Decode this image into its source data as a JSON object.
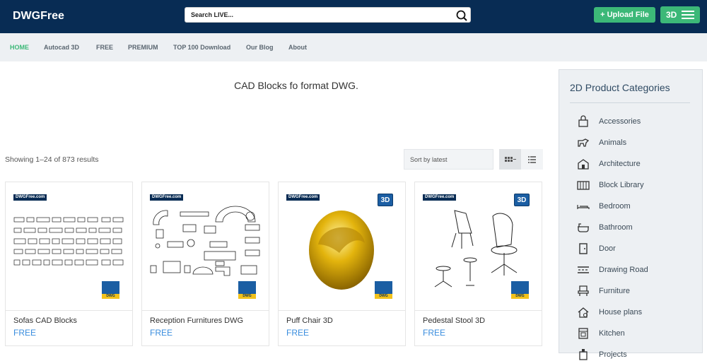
{
  "header": {
    "logo": "DWGFree",
    "search_placeholder": "Search LIVE...",
    "upload_label": "+ Upload File",
    "threed_label": "3D"
  },
  "nav": {
    "items": [
      {
        "label": "HOME",
        "active": true
      },
      {
        "label": "Autocad 3D"
      },
      {
        "label": "FREE"
      },
      {
        "label": "PREMIUM"
      },
      {
        "label": "TOP 100 Download"
      },
      {
        "label": "Our Blog"
      },
      {
        "label": "About"
      }
    ]
  },
  "main": {
    "heading": "CAD Blocks fo format DWG.",
    "results_text": "Showing 1–24 of 873 results",
    "sort_label": "Sort by latest"
  },
  "products": [
    {
      "title": "Sofas CAD Blocks",
      "price": "FREE",
      "tag": "DWGFree.com",
      "badge": "DWG"
    },
    {
      "title": "Reception Furnitures DWG",
      "price": "FREE",
      "tag": "DWGFree.com",
      "badge": "DWG"
    },
    {
      "title": "Puff Chair 3D",
      "price": "FREE",
      "tag": "DWGFree.com",
      "badge": "DWG",
      "badge_3d": "3D"
    },
    {
      "title": "Pedestal Stool 3D",
      "price": "FREE",
      "tag": "DWGFree.com",
      "badge": "DWG",
      "badge_3d": "3D"
    }
  ],
  "sidebar": {
    "title": "2D Product Categories",
    "categories": [
      {
        "label": "Accessories",
        "icon": "bag-icon"
      },
      {
        "label": "Animals",
        "icon": "animal-icon"
      },
      {
        "label": "Architecture",
        "icon": "building-icon"
      },
      {
        "label": "Block Library",
        "icon": "library-icon"
      },
      {
        "label": "Bedroom",
        "icon": "bed-icon"
      },
      {
        "label": "Bathroom",
        "icon": "bathtub-icon"
      },
      {
        "label": "Door",
        "icon": "door-icon"
      },
      {
        "label": "Drawing Road",
        "icon": "road-icon"
      },
      {
        "label": "Furniture",
        "icon": "chair-icon"
      },
      {
        "label": "House plans",
        "icon": "house-icon"
      },
      {
        "label": "Kitchen",
        "icon": "stove-icon"
      },
      {
        "label": "Projects",
        "icon": "project-icon"
      }
    ]
  },
  "colors": {
    "header_bg": "#082c54",
    "accent_green": "#3cb878",
    "price_blue": "#3a8dde",
    "nav_bg": "#edf0f3"
  }
}
